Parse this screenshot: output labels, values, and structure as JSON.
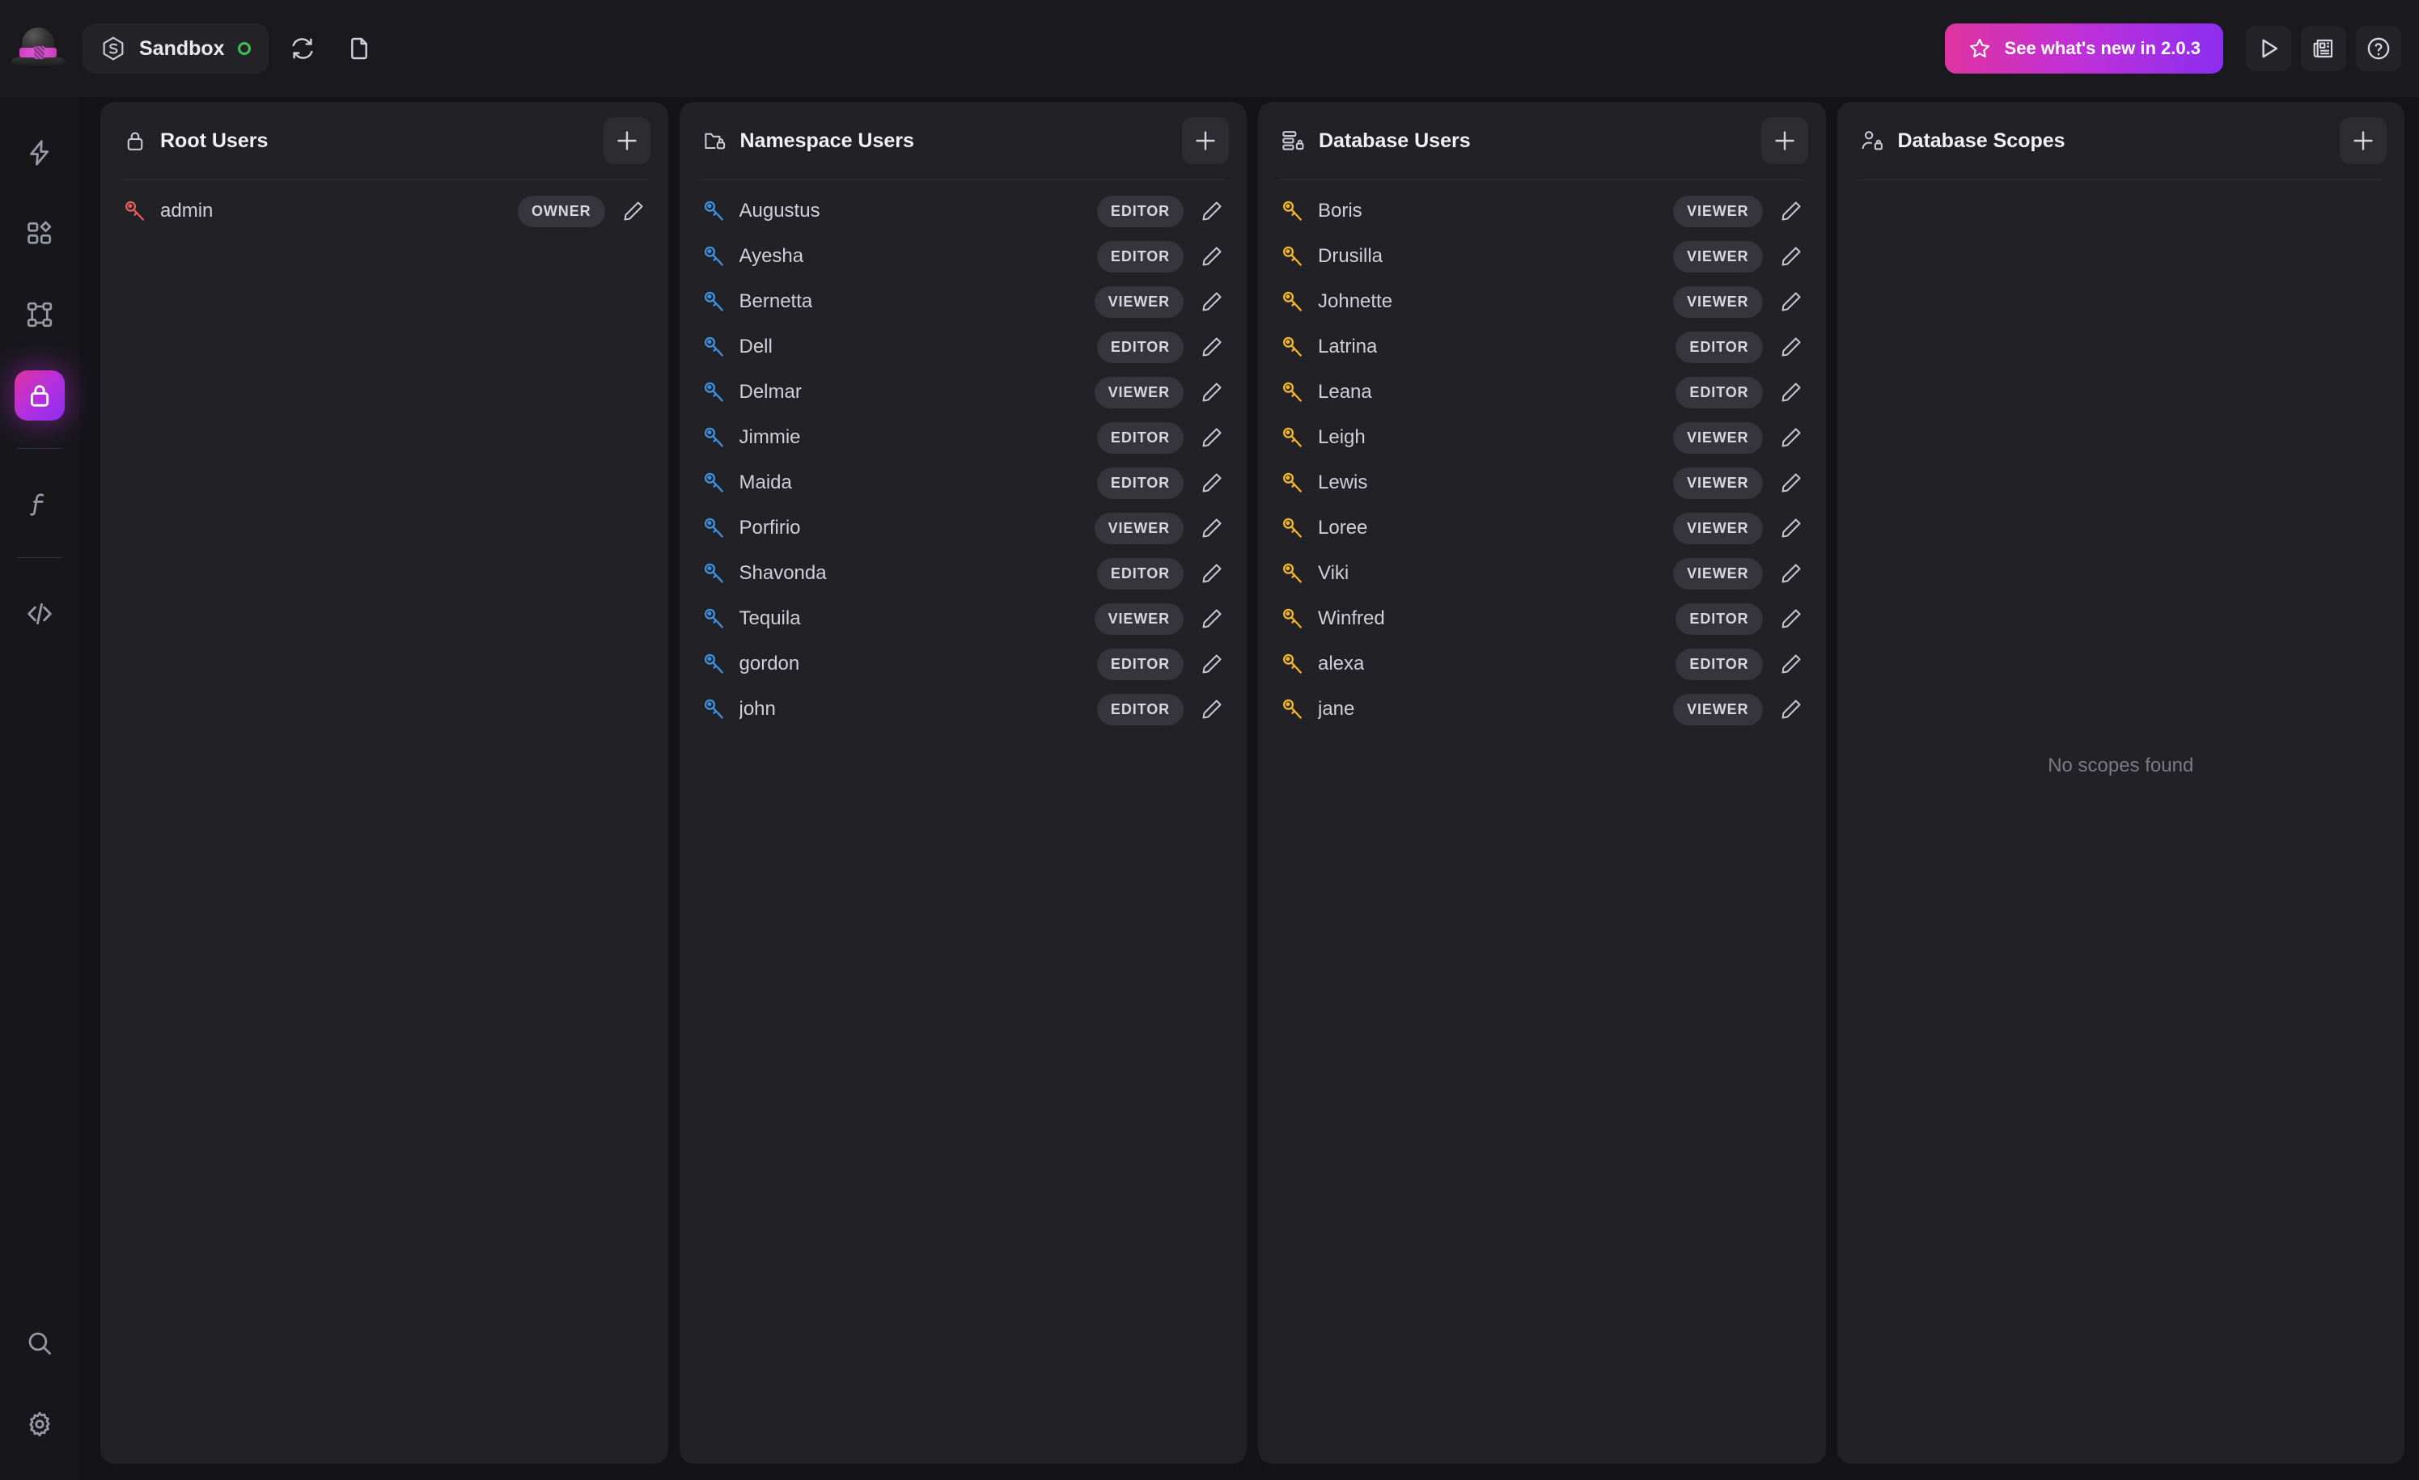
{
  "topbar": {
    "logo_icon": "bowler-hat-logo",
    "workspace": {
      "icon": "surrealdb-hex-icon",
      "label": "Sandbox",
      "status": "online",
      "status_color": "#3fbf55"
    },
    "actions": [
      {
        "icon": "refresh-icon",
        "name": "reconnect-button"
      },
      {
        "icon": "file-icon",
        "name": "new-file-button"
      }
    ],
    "whats_new": {
      "icon": "star-icon",
      "label": "See what's new in 2.0.3",
      "gradient_from": "#e0339f",
      "gradient_to": "#8b2ef0"
    },
    "right_actions": [
      {
        "icon": "play-icon",
        "name": "run-button"
      },
      {
        "icon": "newspaper-icon",
        "name": "news-button"
      },
      {
        "icon": "help-circle-icon",
        "name": "help-button"
      }
    ]
  },
  "sidebar": {
    "items": [
      {
        "icon": "lightning-icon",
        "name": "sidebar-item-query",
        "active": false
      },
      {
        "icon": "blocks-icon",
        "name": "sidebar-item-explorer",
        "active": false
      },
      {
        "icon": "graph-nodes-icon",
        "name": "sidebar-item-designer",
        "active": false
      },
      {
        "icon": "lock-icon",
        "name": "sidebar-item-authentication",
        "active": true
      },
      {
        "icon": "function-icon",
        "name": "sidebar-item-functions",
        "active": false
      },
      {
        "icon": "code-icon",
        "name": "sidebar-item-api-docs",
        "active": false
      }
    ],
    "bottom_items": [
      {
        "icon": "search-icon",
        "name": "sidebar-item-search"
      },
      {
        "icon": "gear-icon",
        "name": "sidebar-item-settings"
      }
    ],
    "active_gradient_from": "#e0339f",
    "active_gradient_to": "#8b2ef0"
  },
  "panels": [
    {
      "id": "root-users",
      "icon": "lock-icon",
      "title": "Root Users",
      "add_label": "+",
      "key_color": "#e25c5c",
      "empty_text": "",
      "rows": [
        {
          "name": "admin",
          "role": "OWNER"
        }
      ]
    },
    {
      "id": "namespace-users",
      "icon": "folder-lock-icon",
      "title": "Namespace Users",
      "add_label": "+",
      "key_color": "#3f8fe0",
      "empty_text": "",
      "rows": [
        {
          "name": "Augustus",
          "role": "EDITOR"
        },
        {
          "name": "Ayesha",
          "role": "EDITOR"
        },
        {
          "name": "Bernetta",
          "role": "VIEWER"
        },
        {
          "name": "Dell",
          "role": "EDITOR"
        },
        {
          "name": "Delmar",
          "role": "VIEWER"
        },
        {
          "name": "Jimmie",
          "role": "EDITOR"
        },
        {
          "name": "Maida",
          "role": "EDITOR"
        },
        {
          "name": "Porfirio",
          "role": "VIEWER"
        },
        {
          "name": "Shavonda",
          "role": "EDITOR"
        },
        {
          "name": "Tequila",
          "role": "VIEWER"
        },
        {
          "name": "gordon",
          "role": "EDITOR"
        },
        {
          "name": "john",
          "role": "EDITOR"
        }
      ]
    },
    {
      "id": "database-users",
      "icon": "database-lock-icon",
      "title": "Database Users",
      "add_label": "+",
      "key_color": "#f0b42a",
      "empty_text": "",
      "rows": [
        {
          "name": "Boris",
          "role": "VIEWER"
        },
        {
          "name": "Drusilla",
          "role": "VIEWER"
        },
        {
          "name": "Johnette",
          "role": "VIEWER"
        },
        {
          "name": "Latrina",
          "role": "EDITOR"
        },
        {
          "name": "Leana",
          "role": "EDITOR"
        },
        {
          "name": "Leigh",
          "role": "VIEWER"
        },
        {
          "name": "Lewis",
          "role": "VIEWER"
        },
        {
          "name": "Loree",
          "role": "VIEWER"
        },
        {
          "name": "Viki",
          "role": "VIEWER"
        },
        {
          "name": "Winfred",
          "role": "EDITOR"
        },
        {
          "name": "alexa",
          "role": "EDITOR"
        },
        {
          "name": "jane",
          "role": "VIEWER"
        }
      ]
    },
    {
      "id": "database-scopes",
      "icon": "user-lock-icon",
      "title": "Database Scopes",
      "add_label": "+",
      "key_color": "#9b9bad",
      "empty_text": "No scopes found",
      "rows": []
    }
  ]
}
